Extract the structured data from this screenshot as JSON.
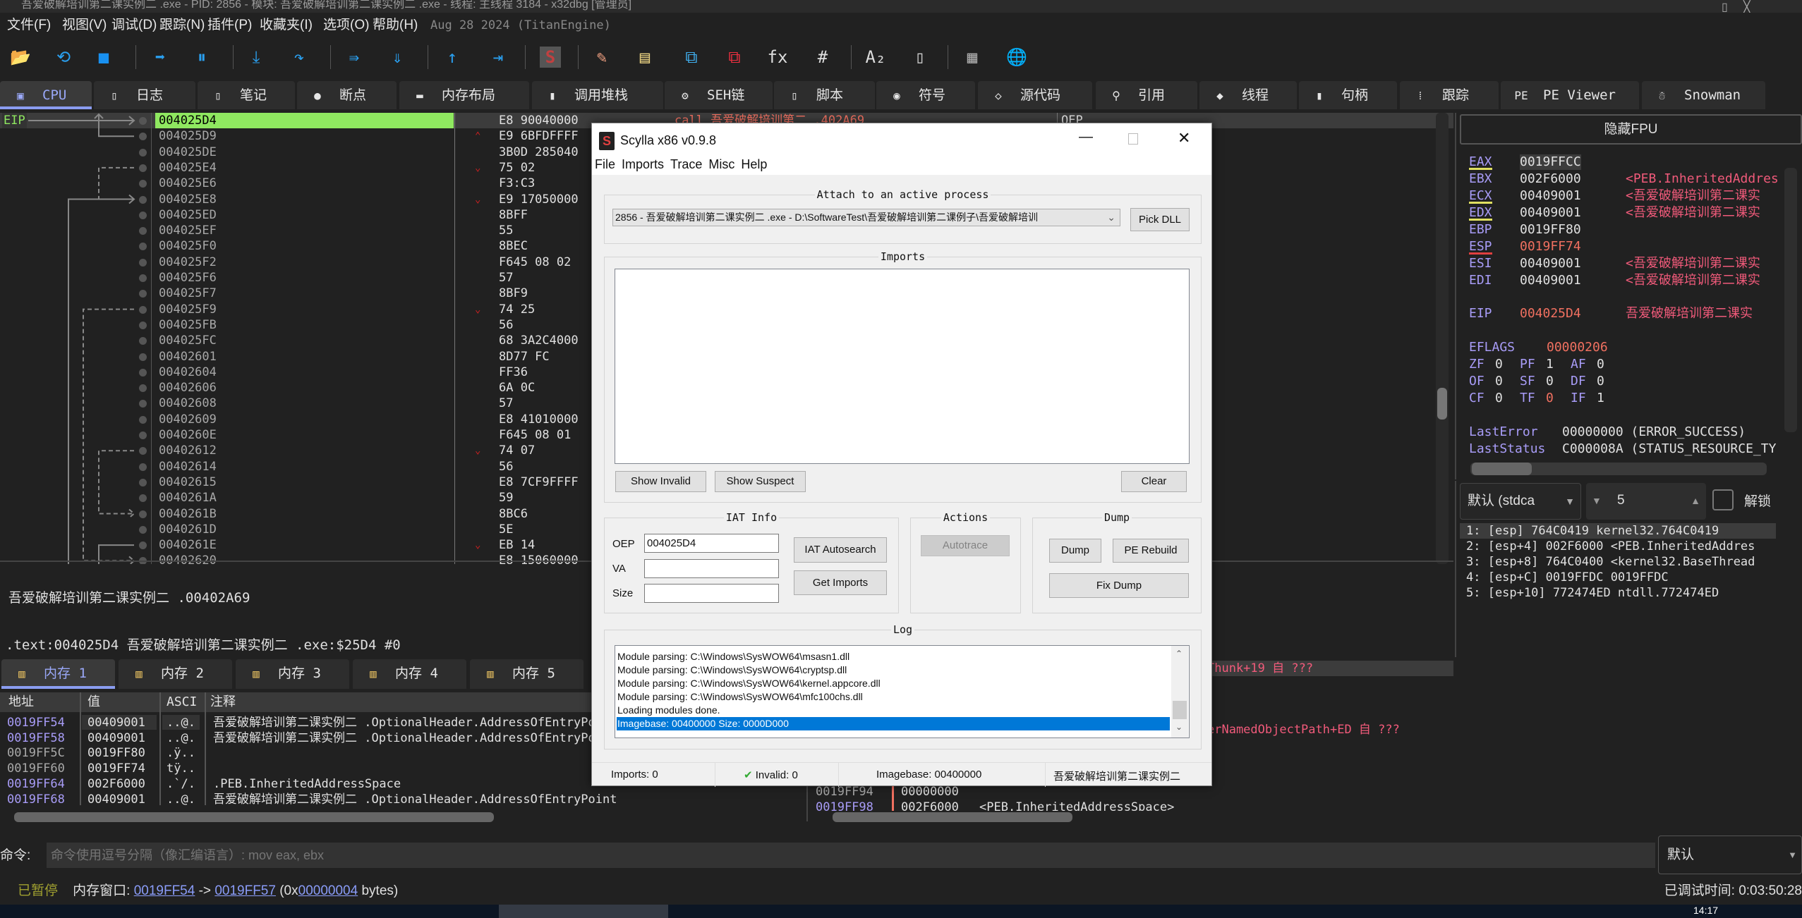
{
  "window_title": "吾爱破解培训第二课实例二 .exe - PID: 2856 - 模块: 吾爱破解培训第二课实例二 .exe - 线程: 主线程 3184 - x32dbg [管理员]",
  "menu": [
    "文件(F)",
    "视图(V)",
    "调试(D)",
    "跟踪(N)",
    "插件(P)",
    "收藏夹(I)",
    "选项(O)",
    "帮助(H)"
  ],
  "build_info": "Aug 28 2024 (TitanEngine)",
  "toolbar": [
    {
      "icon": "open-folder-icon",
      "glyph": "📂"
    },
    {
      "icon": "restart-icon",
      "glyph": "⟲"
    },
    {
      "icon": "stop-icon",
      "glyph": "■"
    },
    {
      "sep": true
    },
    {
      "icon": "run-icon",
      "glyph": "➡"
    },
    {
      "icon": "pause-icon",
      "glyph": "⏸"
    },
    {
      "sep": true
    },
    {
      "icon": "step-into-icon",
      "glyph": "⤓"
    },
    {
      "icon": "step-over-icon",
      "glyph": "↷"
    },
    {
      "sep": true
    },
    {
      "icon": "trace-into-icon",
      "glyph": "⇛"
    },
    {
      "icon": "trace-over-icon",
      "glyph": "⇓"
    },
    {
      "sep": true
    },
    {
      "icon": "execute-till-return-icon",
      "glyph": "↑"
    },
    {
      "icon": "run-to-user-code-icon",
      "glyph": "⇥"
    },
    {
      "sep": true
    },
    {
      "icon": "scylla-icon",
      "glyph": "S"
    },
    {
      "sep": true
    },
    {
      "icon": "patch-icon",
      "glyph": "✎"
    },
    {
      "icon": "comment-icon",
      "glyph": "▤"
    },
    {
      "icon": "label-icon",
      "glyph": "⧉"
    },
    {
      "icon": "bookmark-icon",
      "glyph": "⧉"
    },
    {
      "icon": "function-icon",
      "glyph": "fx"
    },
    {
      "icon": "hash-icon",
      "glyph": "#"
    },
    {
      "sep": true
    },
    {
      "icon": "font-icon",
      "glyph": "A₂"
    },
    {
      "icon": "device-icon",
      "glyph": "▯"
    },
    {
      "sep": true
    },
    {
      "icon": "calculator-icon",
      "glyph": "▦"
    },
    {
      "icon": "globe-icon",
      "glyph": "🌐"
    }
  ],
  "tabs": [
    {
      "label": "CPU",
      "icon": "cpu-icon",
      "glyph": "▣",
      "active": true
    },
    {
      "label": "日志",
      "icon": "log-icon",
      "glyph": "▯"
    },
    {
      "label": "笔记",
      "icon": "notes-icon",
      "glyph": "▯"
    },
    {
      "label": "断点",
      "icon": "breakpoint-icon",
      "glyph": "●"
    },
    {
      "label": "内存布局",
      "icon": "memory-map-icon",
      "glyph": "▬"
    },
    {
      "label": "调用堆栈",
      "icon": "call-stack-icon",
      "glyph": "▮"
    },
    {
      "label": "SEH链",
      "icon": "seh-icon",
      "glyph": "⚙"
    },
    {
      "label": "脚本",
      "icon": "script-icon",
      "glyph": "▯"
    },
    {
      "label": "符号",
      "icon": "symbols-icon",
      "glyph": "◉"
    },
    {
      "label": "源代码",
      "icon": "source-icon",
      "glyph": "◇"
    },
    {
      "label": "引用",
      "icon": "references-icon",
      "glyph": "⚲"
    },
    {
      "label": "线程",
      "icon": "threads-icon",
      "glyph": "◆"
    },
    {
      "label": "句柄",
      "icon": "handles-icon",
      "glyph": "▮"
    },
    {
      "label": "跟踪",
      "icon": "trace-icon",
      "glyph": "⁞"
    },
    {
      "label": "PE Viewer",
      "icon": "pe-viewer-icon",
      "glyph": "PE"
    },
    {
      "label": "Snowman",
      "icon": "snowman-icon",
      "glyph": "☃"
    }
  ],
  "disasm": {
    "eip_label": "EIP",
    "rows": [
      {
        "addr": "004025D4",
        "bytes": "E8 90040000",
        "jump": ""
      },
      {
        "addr": "004025D9",
        "bytes": "E9 6BFDFFFF",
        "jump": "up"
      },
      {
        "addr": "004025DE",
        "bytes": "3B0D 285040",
        "jump": ""
      },
      {
        "addr": "004025E4",
        "bytes": "75 02",
        "jump": "down"
      },
      {
        "addr": "004025E6",
        "bytes": "F3:C3",
        "jump": ""
      },
      {
        "addr": "004025E8",
        "bytes": "E9 17050000",
        "jump": "down"
      },
      {
        "addr": "004025ED",
        "bytes": "8BFF",
        "jump": ""
      },
      {
        "addr": "004025EF",
        "bytes": "55",
        "jump": ""
      },
      {
        "addr": "004025F0",
        "bytes": "8BEC",
        "jump": ""
      },
      {
        "addr": "004025F2",
        "bytes": "F645 08 02",
        "jump": ""
      },
      {
        "addr": "004025F6",
        "bytes": "57",
        "jump": ""
      },
      {
        "addr": "004025F7",
        "bytes": "8BF9",
        "jump": ""
      },
      {
        "addr": "004025F9",
        "bytes": "74 25",
        "jump": "down"
      },
      {
        "addr": "004025FB",
        "bytes": "56",
        "jump": ""
      },
      {
        "addr": "004025FC",
        "bytes": "68 3A2C4000",
        "jump": ""
      },
      {
        "addr": "00402601",
        "bytes": "8D77 FC",
        "jump": ""
      },
      {
        "addr": "00402604",
        "bytes": "FF36",
        "jump": ""
      },
      {
        "addr": "00402606",
        "bytes": "6A 0C",
        "jump": ""
      },
      {
        "addr": "00402608",
        "bytes": "57",
        "jump": ""
      },
      {
        "addr": "00402609",
        "bytes": "E8 41010000",
        "jump": ""
      },
      {
        "addr": "0040260E",
        "bytes": "F645 08 01",
        "jump": ""
      },
      {
        "addr": "00402612",
        "bytes": "74 07",
        "jump": "down"
      },
      {
        "addr": "00402614",
        "bytes": "56",
        "jump": ""
      },
      {
        "addr": "00402615",
        "bytes": "E8 7CF9FFFF",
        "jump": ""
      },
      {
        "addr": "0040261A",
        "bytes": "59",
        "jump": ""
      },
      {
        "addr": "0040261B",
        "bytes": "8BC6",
        "jump": ""
      },
      {
        "addr": "0040261D",
        "bytes": "5E",
        "jump": ""
      },
      {
        "addr": "0040261E",
        "bytes": "EB 14",
        "jump": "down"
      },
      {
        "addr": "00402620",
        "bytes": "E8 15060000",
        "jump": ""
      }
    ],
    "first_instruction": "call 吾爱破解培训第二 .402A69",
    "first_comment": "OEP"
  },
  "info": {
    "line1": "吾爱破解培训第二课实例二 .00402A69",
    "line2": ".text:004025D4 吾爱破解培训第二课实例二 .exe:$25D4 #0"
  },
  "registers": {
    "hide_fpu": "隐藏FPU",
    "rows": [
      {
        "name": "EAX",
        "value": "0019FFCC",
        "comment": "",
        "mark": "yellow",
        "modified": false
      },
      {
        "name": "EBX",
        "value": "002F6000",
        "comment": "<PEB.InheritedAddres",
        "mark": "",
        "modified": false
      },
      {
        "name": "ECX",
        "value": "00409001",
        "comment": "<吾爱破解培训第二课实",
        "mark": "yellow",
        "modified": false
      },
      {
        "name": "EDX",
        "value": "00409001",
        "comment": "<吾爱破解培训第二课实",
        "mark": "yellow",
        "modified": false
      },
      {
        "name": "EBP",
        "value": "0019FF80",
        "comment": "",
        "mark": "",
        "modified": false
      },
      {
        "name": "ESP",
        "value": "0019FF74",
        "comment": "",
        "mark": "red",
        "modified": true
      },
      {
        "name": "ESI",
        "value": "00409001",
        "comment": "<吾爱破解培训第二课实",
        "mark": "",
        "modified": false
      },
      {
        "name": "EDI",
        "value": "00409001",
        "comment": "<吾爱破解培训第二课实",
        "mark": "",
        "modified": false
      }
    ],
    "eip": {
      "name": "EIP",
      "value": "004025D4",
      "comment": "吾爱破解培训第二课实"
    },
    "eflags": {
      "name": "EFLAGS",
      "value": "00000206"
    },
    "flags": [
      [
        {
          "n": "ZF",
          "v": "0"
        },
        {
          "n": "PF",
          "v": "1"
        },
        {
          "n": "AF",
          "v": "0"
        }
      ],
      [
        {
          "n": "OF",
          "v": "0"
        },
        {
          "n": "SF",
          "v": "0"
        },
        {
          "n": "DF",
          "v": "0"
        }
      ],
      [
        {
          "n": "CF",
          "v": "0"
        },
        {
          "n": "TF",
          "v": "0",
          "modified": true
        },
        {
          "n": "IF",
          "v": "1"
        }
      ]
    ],
    "last_error": {
      "name": "LastError",
      "value": "00000000 (ERROR_SUCCESS)"
    },
    "last_status": {
      "name": "LastStatus",
      "value": "C000008A (STATUS_RESOURCE_TY"
    }
  },
  "callstack_args": {
    "convention": "默认 (stdca",
    "count": "5",
    "unlock_label": "解锁",
    "unlock_checked": false,
    "rows": [
      "1: [esp] 764C0419 kernel32.764C0419",
      "2: [esp+4] 002F6000 <PEB.InheritedAddres",
      "3: [esp+8] 764C0400 <kernel32.BaseThread",
      "4: [esp+C] 0019FFDC 0019FFDC",
      "5: [esp+10] 772474ED ntdll.772474ED"
    ]
  },
  "dump_tabs": [
    "内存 1",
    "内存 2",
    "内存 3",
    "内存 4",
    "内存 5"
  ],
  "dump": {
    "headers": [
      "地址",
      "值",
      "ASCI",
      "注释"
    ],
    "rows": [
      {
        "addr": "0019FF54",
        "value": "00409001",
        "ascii": "..@.",
        "comment": "吾爱破解培训第二课实例二 .OptionalHeader.AddressOfEntryPoint",
        "ptr": true
      },
      {
        "addr": "0019FF58",
        "value": "00409001",
        "ascii": "..@.",
        "comment": "吾爱破解培训第二课实例二 .OptionalHeader.AddressOfEntryPoint",
        "ptr": true
      },
      {
        "addr": "0019FF5C",
        "value": "0019FF80",
        "ascii": ".ÿ..",
        "comment": "",
        "ptr": false
      },
      {
        "addr": "0019FF60",
        "value": "0019FF74",
        "ascii": "tÿ..",
        "comment": "",
        "ptr": false
      },
      {
        "addr": "0019FF64",
        "value": "002F6000",
        "ascii": ".`/.",
        "comment": ".PEB.InheritedAddressSpace",
        "ptr": true
      },
      {
        "addr": "0019FF68",
        "value": "00409001",
        "ascii": "..@.",
        "comment": "吾爱破解培训第二课实例二 .OptionalHeader.AddressOfEntryPoint",
        "ptr": true
      }
    ]
  },
  "stack": {
    "fragment1": "Thunk+19 自 ???",
    "fragment2": "erNamedObjectPath+ED 自 ???",
    "rows": [
      {
        "addr": "0019FF94",
        "value": "00000000",
        "comment": ""
      },
      {
        "addr": "0019FF98",
        "value": "002F6000",
        "comment": "<PEB.InheritedAddressSpace>"
      }
    ]
  },
  "command": {
    "label": "命令:",
    "placeholder": "命令使用逗号分隔（像汇编语言）: mov eax, ebx",
    "mode": "默认"
  },
  "status": {
    "state": "已暂停",
    "mem_label": "内存窗口:",
    "from": "0019FF54",
    "arrow": "->",
    "to": "0019FF57",
    "size_prefix": "(0x",
    "size": "00000004",
    "size_suffix": "bytes)",
    "time_label": "已调试时间:",
    "time": "0:03:50:28"
  },
  "taskbar": {
    "clock": "14:17"
  },
  "scylla": {
    "title": "Scylla x86 v0.9.8",
    "menu": [
      "File",
      "Imports",
      "Trace",
      "Misc",
      "Help"
    ],
    "attach_title": "Attach to an active process",
    "process": "2856 - 吾爱破解培训第二课实例二 .exe - D:\\SoftwareTest\\吾爱破解培训第二课例子\\吾爱破解培训",
    "pick_dll": "Pick DLL",
    "imports_title": "Imports",
    "show_invalid": "Show Invalid",
    "show_suspect": "Show Suspect",
    "clear": "Clear",
    "iat_title": "IAT Info",
    "oep_label": "OEP",
    "oep_value": "004025D4",
    "va_label": "VA",
    "va_value": "",
    "size_label": "Size",
    "size_value": "",
    "iat_autosearch": "IAT Autosearch",
    "get_imports": "Get Imports",
    "actions_title": "Actions",
    "autotrace": "Autotrace",
    "dump_title": "Dump",
    "dump": "Dump",
    "pe_rebuild": "PE Rebuild",
    "fix_dump": "Fix Dump",
    "log_title": "Log",
    "log": [
      "Module parsing: C:\\Windows\\SysWOW64\\msasn1.dll",
      "Module parsing: C:\\Windows\\SysWOW64\\cryptsp.dll",
      "Module parsing: C:\\Windows\\SysWOW64\\kernel.appcore.dll",
      "Module parsing: C:\\Windows\\SysWOW64\\mfc100chs.dll",
      "Loading modules done.",
      "Imagebase: 00400000 Size: 0000D000"
    ],
    "log_selected": 5,
    "status": {
      "imports": "Imports: 0",
      "invalid": "Invalid: 0",
      "imagebase": "Imagebase: 00400000",
      "module": "吾爱破解培训第二课实例二"
    }
  },
  "colors": {
    "eip_highlight": "#8fe860",
    "register_label": "#a89cf7",
    "comment": "#f05a7a",
    "modified": "#f07060",
    "link": "#8a9cf8",
    "paused": "#a0a030",
    "selection": "#0078d7"
  }
}
